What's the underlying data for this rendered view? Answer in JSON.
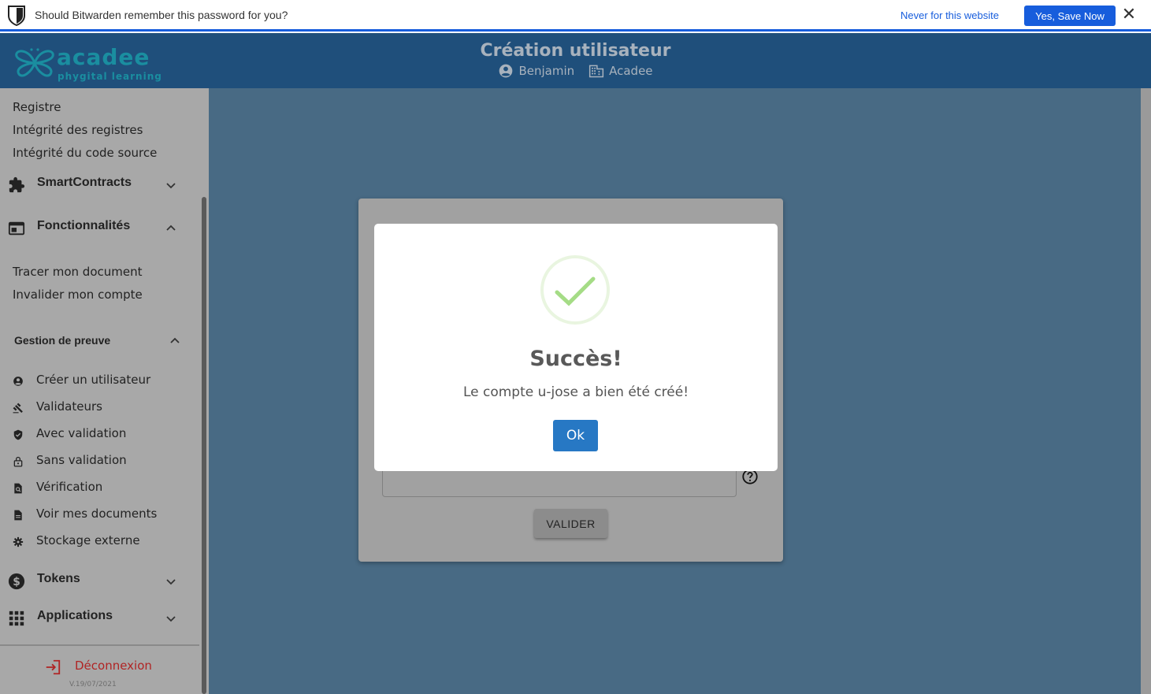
{
  "bitwarden": {
    "prompt": "Should Bitwarden remember this password for you?",
    "never_label": "Never for this website",
    "save_label": "Yes, Save Now",
    "close_symbol": "✕"
  },
  "header": {
    "logo_word": "acadee",
    "logo_tagline": "phygital learning",
    "title": "Création utilisateur",
    "user": "Benjamin",
    "organization": "Acadee"
  },
  "sidebar": {
    "top_links": [
      "Registre",
      "Intégrité des registres",
      "Intégrité du code source"
    ],
    "smartcontracts": {
      "label": "SmartContracts",
      "icon": "puzzle-icon"
    },
    "fonctionnalites": {
      "label": "Fonctionnalités",
      "icon": "web-window-icon",
      "links": [
        "Tracer mon document",
        "Invalider mon compte"
      ]
    },
    "gestion_preuve": {
      "label": "Gestion de preuve",
      "items": [
        {
          "label": "Créer un utilisateur",
          "icon": "account-circle-icon"
        },
        {
          "label": "Validateurs",
          "icon": "gavel-icon"
        },
        {
          "label": "Avec validation",
          "icon": "verified-shield-icon"
        },
        {
          "label": "Sans validation",
          "icon": "lock-open-icon"
        },
        {
          "label": "Vérification",
          "icon": "find-document-icon"
        },
        {
          "label": "Voir mes documents",
          "icon": "document-icon"
        },
        {
          "label": "Stockage externe",
          "icon": "gear-icon"
        }
      ]
    },
    "tokens": {
      "label": "Tokens",
      "icon": "dollar-coin-icon"
    },
    "applications": {
      "label": "Applications",
      "icon": "apps-grid-icon"
    },
    "logout_label": "Déconnexion",
    "version": "V.19/07/2021"
  },
  "form": {
    "password_value": "••••••••••••••••••••••••••",
    "submit_label": "VALIDER"
  },
  "modal": {
    "title": "Succès!",
    "message": "Le compte u-jose a bien été créé!",
    "ok_label": "Ok"
  },
  "colors": {
    "bitwarden_blue": "#175ddc",
    "header_bg": "#1f4f7b",
    "sidebar_bg": "#a8a8a8",
    "main_overlay": "#486a84",
    "success_green": "#a5dc86",
    "ok_button": "#2778c4",
    "logout_red": "#b02424"
  }
}
